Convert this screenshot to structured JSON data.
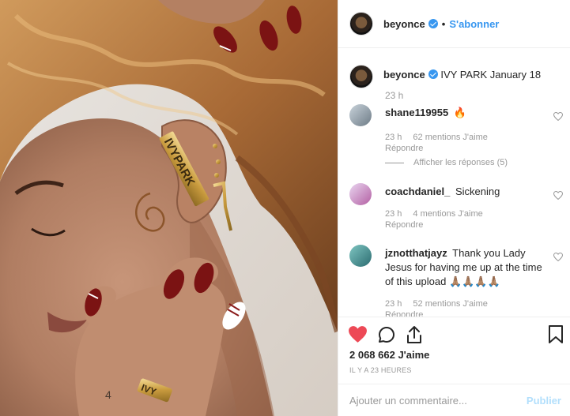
{
  "header": {
    "username": "beyonce",
    "separator": "•",
    "follow_label": "S'abonner"
  },
  "caption": {
    "username": "beyonce",
    "text": "IVY PARK January 18",
    "age": "23 h"
  },
  "comments": [
    {
      "username": "shane119955",
      "text": "🔥",
      "age": "23 h",
      "likes": "62 mentions J'aime",
      "reply": "Répondre",
      "view_replies": "Afficher les réponses (5)"
    },
    {
      "username": "coachdaniel_",
      "text": "Sickening",
      "age": "23 h",
      "likes": "4 mentions J'aime",
      "reply": "Répondre"
    },
    {
      "username": "jznotthatjayz",
      "text": "Thank you Lady Jesus for having me up at the time of this upload 🙏🏽🙏🏽🙏🏽🙏🏽",
      "age": "23 h",
      "likes": "52 mentions J'aime",
      "reply": "Répondre"
    }
  ],
  "post": {
    "likes": "2 068 662 J'aime",
    "timestamp": "IL Y A 23 HEURES",
    "comment_placeholder": "Ajouter un commentaire...",
    "publish_label": "Publier",
    "liked": true
  },
  "photo": {
    "earring_text": "IVYPARK",
    "ring_text": "IVY"
  },
  "colors": {
    "accent": "#3897f0",
    "like": "#ed4956",
    "muted": "#999999",
    "publish_disabled": "#b2dffc"
  },
  "icons": [
    "verified-icon",
    "heart-icon",
    "comment-icon",
    "share-icon",
    "bookmark-icon",
    "heart-outline-icon"
  ]
}
